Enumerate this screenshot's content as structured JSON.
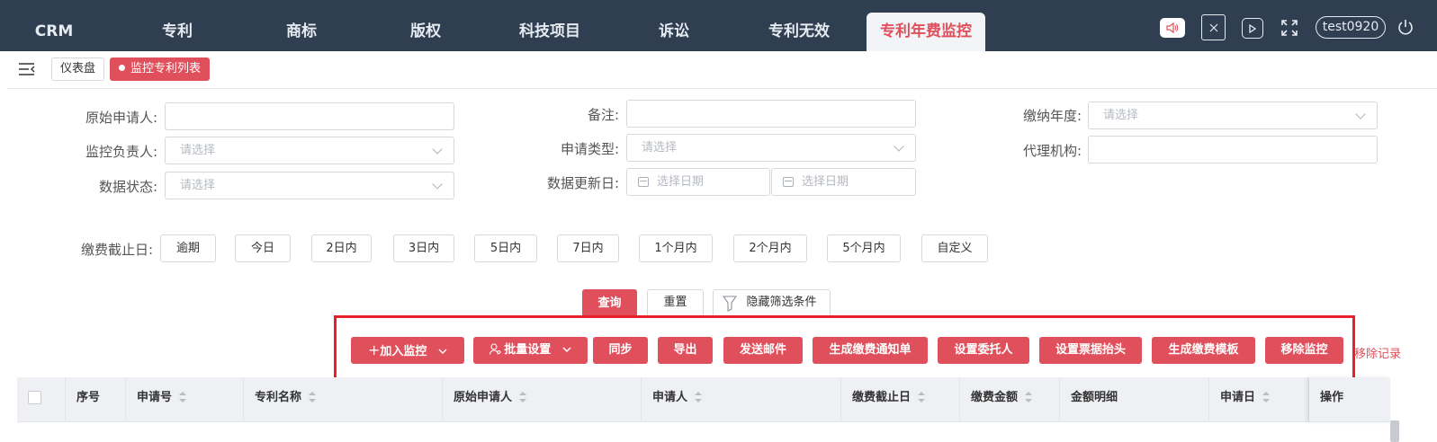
{
  "nav": {
    "tabs": [
      "CRM",
      "专利",
      "商标",
      "版权",
      "科技项目",
      "诉讼",
      "专利无效",
      "专利年费监控"
    ],
    "active_tab": "专利年费监控",
    "user": "test0920",
    "icons": [
      "speaker-icon",
      "close-box-icon",
      "play-icon",
      "fullscreen-icon",
      "power-icon"
    ]
  },
  "breadcrumb": {
    "items": [
      "仪表盘",
      "监控专利列表"
    ]
  },
  "filters": {
    "original_applicant": {
      "label": "原始申请人:",
      "value": ""
    },
    "remark": {
      "label": "备注:",
      "value": ""
    },
    "payment_year": {
      "label": "缴纳年度:",
      "placeholder": "请选择"
    },
    "monitor_owner": {
      "label": "监控负责人:",
      "placeholder": "请选择"
    },
    "apply_type": {
      "label": "申请类型:",
      "placeholder": "请选择"
    },
    "agency": {
      "label": "代理机构:",
      "value": ""
    },
    "data_status": {
      "label": "数据状态:",
      "placeholder": "请选择"
    },
    "update_date": {
      "label": "数据更新日:",
      "start_placeholder": "选择日期",
      "end_placeholder": "选择日期"
    },
    "deadline": {
      "label": "缴费截止日:",
      "options": [
        "逾期",
        "今日",
        "2日内",
        "3日内",
        "5日内",
        "7日内",
        "1个月内",
        "2个月内",
        "5个月内",
        "自定义"
      ]
    }
  },
  "query_buttons": {
    "search": "查询",
    "reset": "重置",
    "hide_filter": "隐藏筛选条件"
  },
  "actions": [
    "加入监控",
    "批量设置",
    "同步",
    "导出",
    "发送邮件",
    "生成缴费通知单",
    "设置委托人",
    "设置票据抬头",
    "生成缴费模板",
    "移除监控"
  ],
  "remove_record_link": "移除记录",
  "table": {
    "columns": [
      "序号",
      "申请号",
      "专利名称",
      "原始申请人",
      "申请人",
      "缴费截止日",
      "缴费金额",
      "金额明细",
      "申请日",
      "操作"
    ]
  },
  "colors": {
    "nav_bg": "#2f3e51",
    "primary": "#e0505c",
    "highlight_frame": "#e8202a"
  }
}
